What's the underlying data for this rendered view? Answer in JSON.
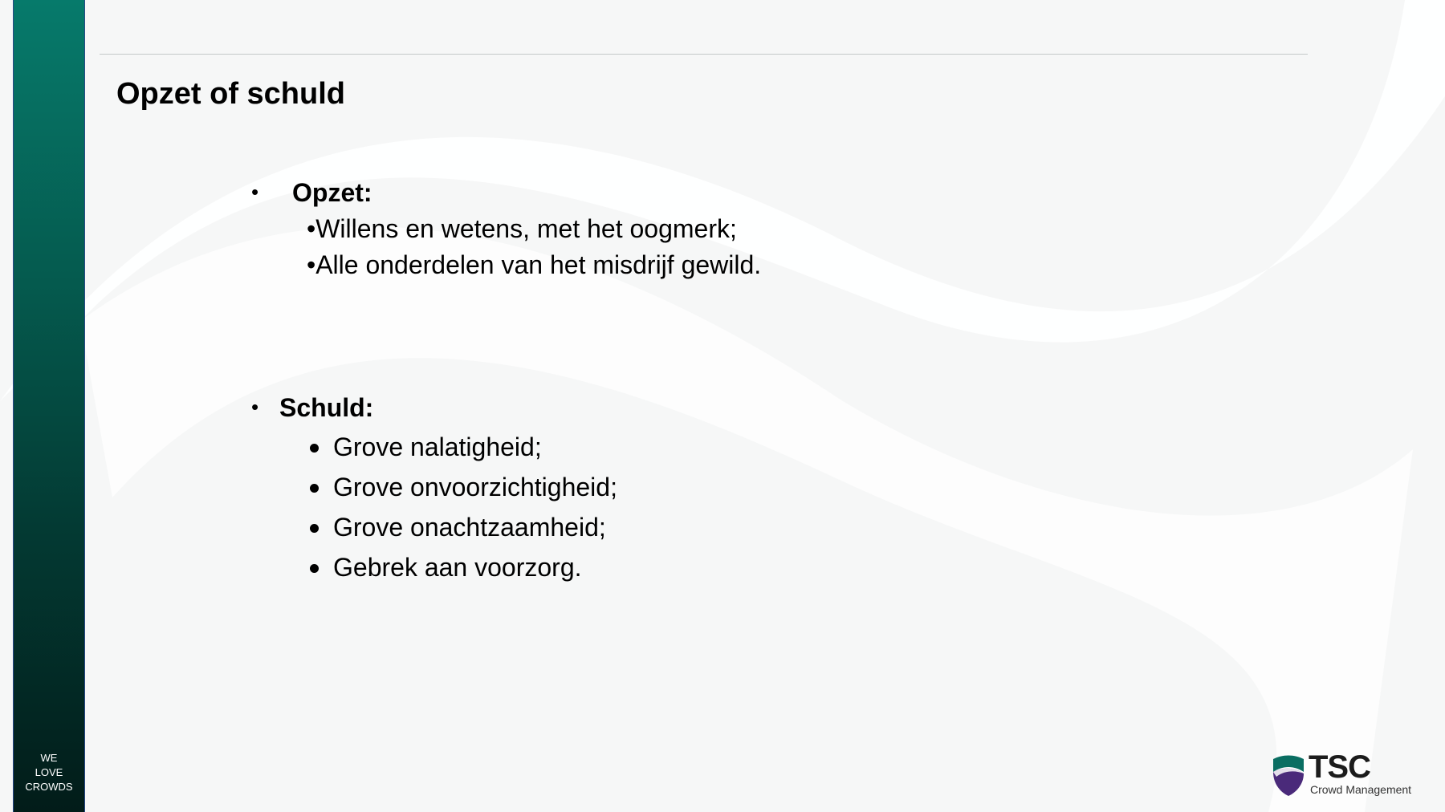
{
  "slide": {
    "title": "Opzet of schuld",
    "sidebar_text": [
      "WE",
      "LOVE",
      "CROWDS"
    ],
    "sections": [
      {
        "heading": "Opzet:",
        "items": [
          "Willens en wetens, met het oogmerk;",
          "Alle onderdelen van het misdrijf gewild."
        ]
      },
      {
        "heading": "Schuld:",
        "items": [
          "Grove nalatigheid;",
          "Grove onvoorzichtigheid;",
          "Grove onachtzaamheid;",
          "Gebrek aan voorzorg."
        ]
      }
    ],
    "logo": {
      "name": "TSC",
      "subtitle": "Crowd Management",
      "colors": {
        "teal": "#0a6e62",
        "purple": "#4a2a7a"
      }
    }
  },
  "colors": {
    "background": "#f6f7f7",
    "sidebar_top": "#067a6b",
    "sidebar_bottom": "#021c19"
  }
}
